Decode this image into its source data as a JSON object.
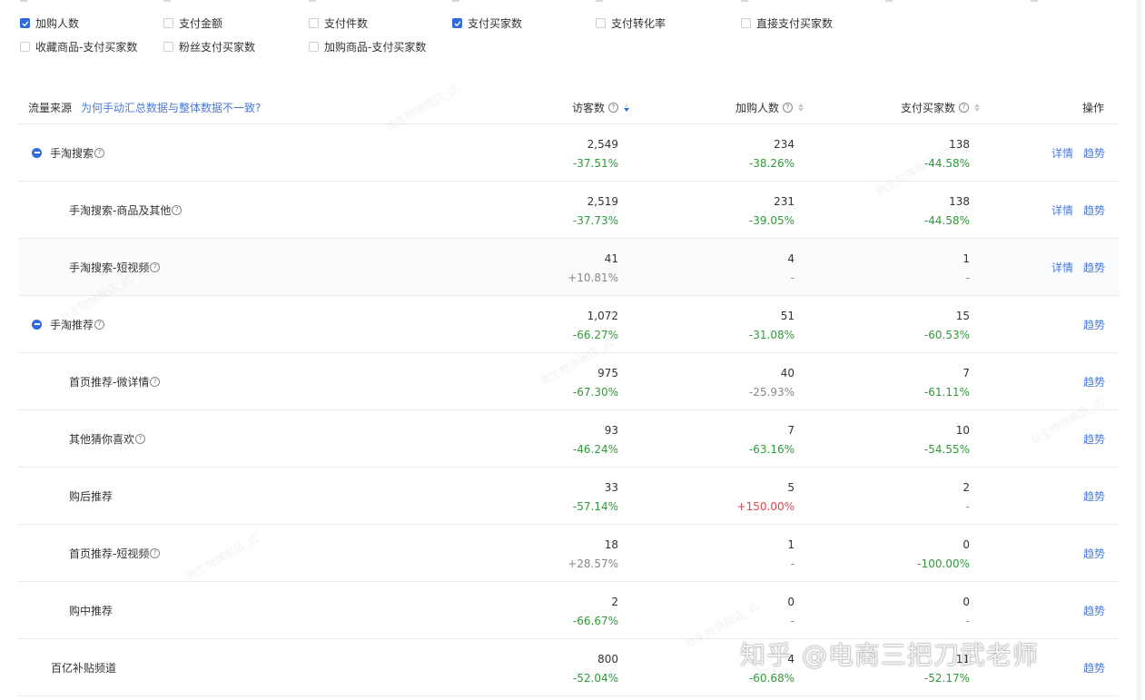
{
  "metrics": [
    {
      "label": "加购人数",
      "checked": true
    },
    {
      "label": "支付金额",
      "checked": false
    },
    {
      "label": "支付件数",
      "checked": false
    },
    {
      "label": "支付买家数",
      "checked": true
    },
    {
      "label": "支付转化率",
      "checked": false
    },
    {
      "label": "直接支付买家数",
      "checked": false
    },
    {
      "label": "收藏商品-支付买家数",
      "checked": false
    },
    {
      "label": "粉丝支付买家数",
      "checked": false
    },
    {
      "label": "加购商品-支付买家数",
      "checked": false
    }
  ],
  "table": {
    "header": {
      "source": "流量来源",
      "help_link": "为何手动汇总数据与整体数据不一致?",
      "visitors": "访客数",
      "add_cart": "加购人数",
      "buyers": "支付买家数",
      "ops": "操作"
    },
    "ops_labels": {
      "detail": "详情",
      "trend": "趋势"
    },
    "rows": [
      {
        "name": "手淘搜索",
        "level": 0,
        "expanded": true,
        "help": true,
        "visitors": "2,549",
        "visitors_change": "-37.51%",
        "add_cart": "234",
        "add_cart_change": "-38.26%",
        "buyers": "138",
        "buyers_change": "-44.58%",
        "detail": true
      },
      {
        "name": "手淘搜索-商品及其他",
        "level": 1,
        "help": true,
        "visitors": "2,519",
        "visitors_change": "-37.73%",
        "add_cart": "231",
        "add_cart_change": "-39.05%",
        "buyers": "138",
        "buyers_change": "-44.58%",
        "detail": true
      },
      {
        "name": "手淘搜索-短视频",
        "level": 1,
        "help": true,
        "visitors": "41",
        "visitors_change": "+10.81%",
        "add_cart": "4",
        "add_cart_change": "-",
        "buyers": "1",
        "buyers_change": "-",
        "detail": true
      },
      {
        "name": "手淘推荐",
        "level": 0,
        "expanded": true,
        "help": true,
        "visitors": "1,072",
        "visitors_change": "-66.27%",
        "add_cart": "51",
        "add_cart_change": "-31.08%",
        "buyers": "15",
        "buyers_change": "-60.53%",
        "detail": false
      },
      {
        "name": "首页推荐-微详情",
        "level": 1,
        "help": true,
        "visitors": "975",
        "visitors_change": "-67.30%",
        "add_cart": "40",
        "add_cart_change": "-25.93%",
        "buyers": "7",
        "buyers_change": "-61.11%",
        "detail": false
      },
      {
        "name": "其他猜你喜欢",
        "level": 1,
        "help": true,
        "visitors": "93",
        "visitors_change": "-46.24%",
        "add_cart": "7",
        "add_cart_change": "-63.16%",
        "buyers": "10",
        "buyers_change": "-54.55%",
        "detail": false
      },
      {
        "name": "购后推荐",
        "level": 1,
        "help": false,
        "visitors": "33",
        "visitors_change": "-57.14%",
        "add_cart": "5",
        "add_cart_change": "+150.00%",
        "buyers": "2",
        "buyers_change": "-",
        "detail": false
      },
      {
        "name": "首页推荐-短视频",
        "level": 1,
        "help": true,
        "visitors": "18",
        "visitors_change": "+28.57%",
        "add_cart": "1",
        "add_cart_change": "-",
        "buyers": "0",
        "buyers_change": "-100.00%",
        "detail": false
      },
      {
        "name": "购中推荐",
        "level": 1,
        "help": false,
        "visitors": "2",
        "visitors_change": "-66.67%",
        "add_cart": "0",
        "add_cart_change": "-",
        "buyers": "0",
        "buyers_change": "-",
        "detail": false
      },
      {
        "name": "百亿补贴频道",
        "level": 0,
        "expanded": false,
        "help": false,
        "visitors": "800",
        "visitors_change": "-52.04%",
        "add_cart": "4",
        "add_cart_change": "-60.68%",
        "buyers": "11",
        "buyers_change": "-52.17%",
        "detail": false
      }
    ]
  },
  "watermark_text": "知乎 @电商三把刀武老师",
  "colors": {
    "accent": "#2f6bdf",
    "negative": "#2f9a3a",
    "positive": "#e0454b",
    "link": "#4a7ad8"
  }
}
